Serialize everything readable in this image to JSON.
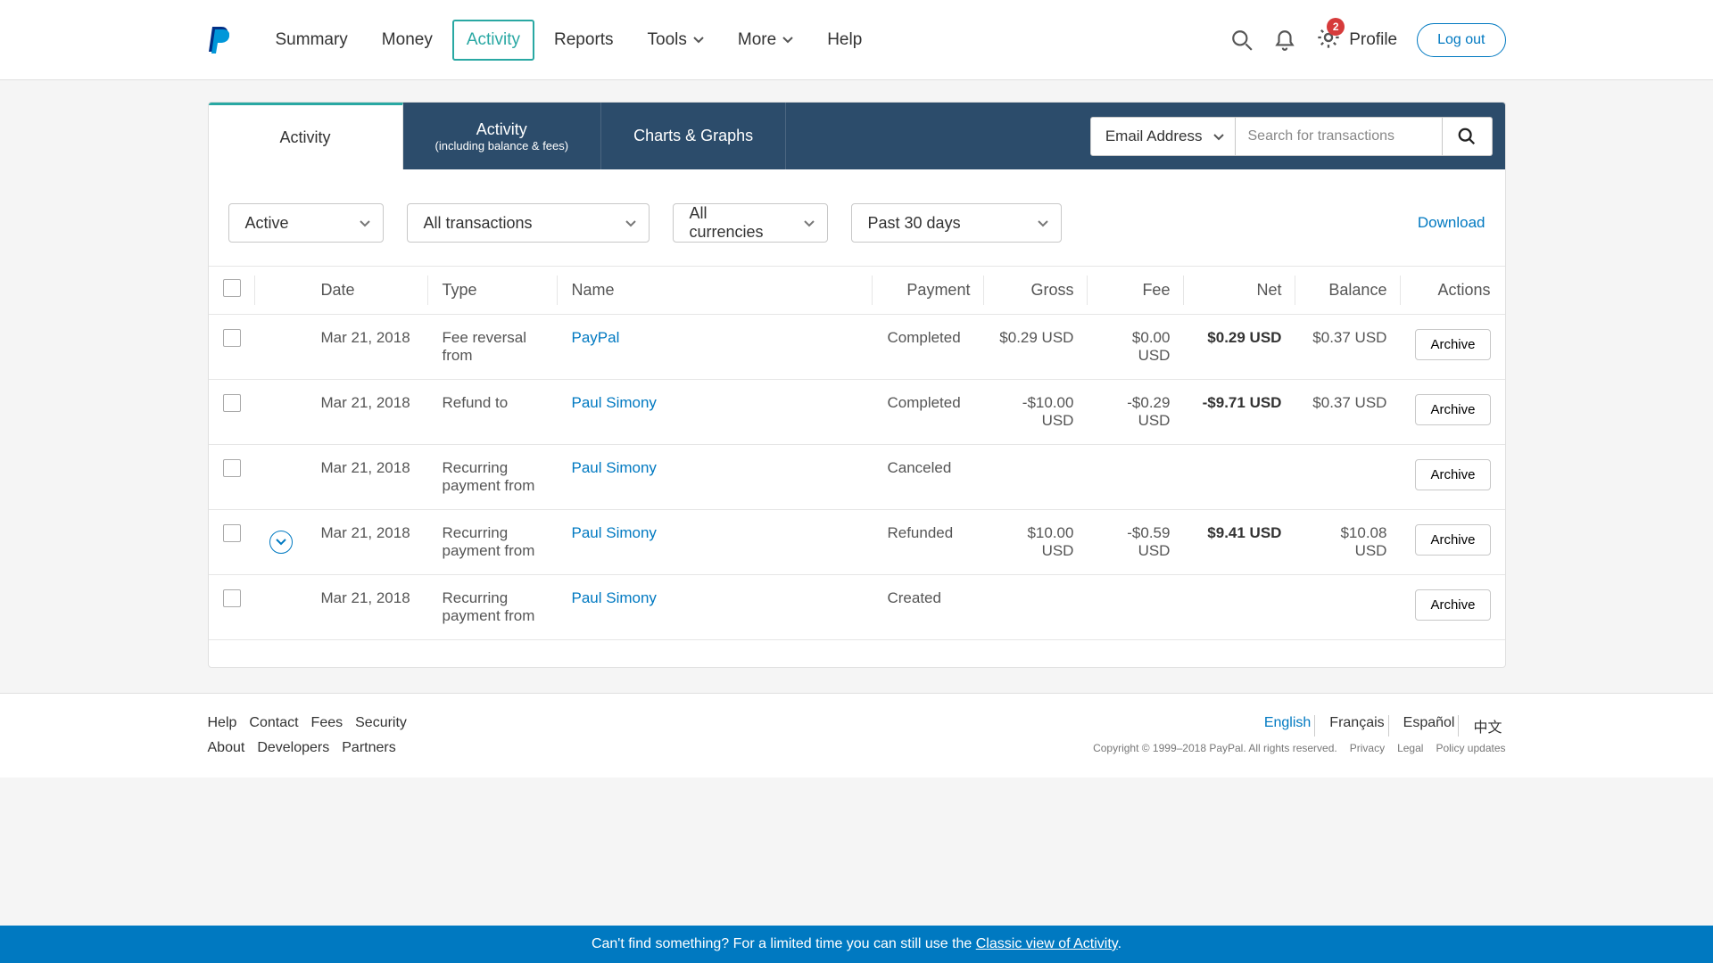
{
  "nav": {
    "items": [
      "Summary",
      "Money",
      "Activity",
      "Reports",
      "Tools",
      "More",
      "Help"
    ],
    "active_index": 2,
    "profile": "Profile",
    "logout": "Log out",
    "badge_count": "2"
  },
  "subtabs": {
    "t0": "Activity",
    "t1_main": "Activity",
    "t1_sub": "(including balance & fees)",
    "t2": "Charts & Graphs"
  },
  "search": {
    "type": "Email Address",
    "placeholder": "Search for transactions"
  },
  "filters": {
    "status": "Active",
    "txn": "All transactions",
    "currency": "All currencies",
    "date": "Past 30 days",
    "download": "Download"
  },
  "table": {
    "headers": {
      "date": "Date",
      "type": "Type",
      "name": "Name",
      "payment": "Payment",
      "gross": "Gross",
      "fee": "Fee",
      "net": "Net",
      "balance": "Balance",
      "actions": "Actions"
    },
    "archive_label": "Archive",
    "rows": [
      {
        "date": "Mar 21, 2018",
        "type": "Fee reversal from",
        "name": "PayPal",
        "payment": "Completed",
        "gross": "$0.29 USD",
        "fee": "$0.00 USD",
        "net": "$0.29 USD",
        "balance": "$0.37 USD",
        "expand": false
      },
      {
        "date": "Mar 21, 2018",
        "type": "Refund to",
        "name": "Paul Simony",
        "payment": "Completed",
        "gross": "-$10.00 USD",
        "fee": "-$0.29 USD",
        "net": "-$9.71 USD",
        "balance": "$0.37 USD",
        "expand": false
      },
      {
        "date": "Mar 21, 2018",
        "type": "Recurring payment from",
        "name": "Paul Simony",
        "payment": "Canceled",
        "gross": "",
        "fee": "",
        "net": "",
        "balance": "",
        "expand": false
      },
      {
        "date": "Mar 21, 2018",
        "type": "Recurring payment from",
        "name": "Paul Simony",
        "payment": "Refunded",
        "gross": "$10.00 USD",
        "fee": "-$0.59 USD",
        "net": "$9.41 USD",
        "balance": "$10.08 USD",
        "expand": true
      },
      {
        "date": "Mar 21, 2018",
        "type": "Recurring payment from",
        "name": "Paul Simony",
        "payment": "Created",
        "gross": "",
        "fee": "",
        "net": "",
        "balance": "",
        "expand": false
      }
    ]
  },
  "footer": {
    "row1": [
      "Help",
      "Contact",
      "Fees",
      "Security"
    ],
    "row2": [
      "About",
      "Developers",
      "Partners"
    ],
    "langs": [
      "English",
      "Français",
      "Español",
      "中文"
    ],
    "copyright": "Copyright © 1999–2018 PayPal. All rights reserved.",
    "legal": [
      "Privacy",
      "Legal",
      "Policy updates"
    ]
  },
  "banner": {
    "pre": "Can't find something? For a limited time you can still use the ",
    "link": "Classic view of Activity",
    "post": "."
  }
}
